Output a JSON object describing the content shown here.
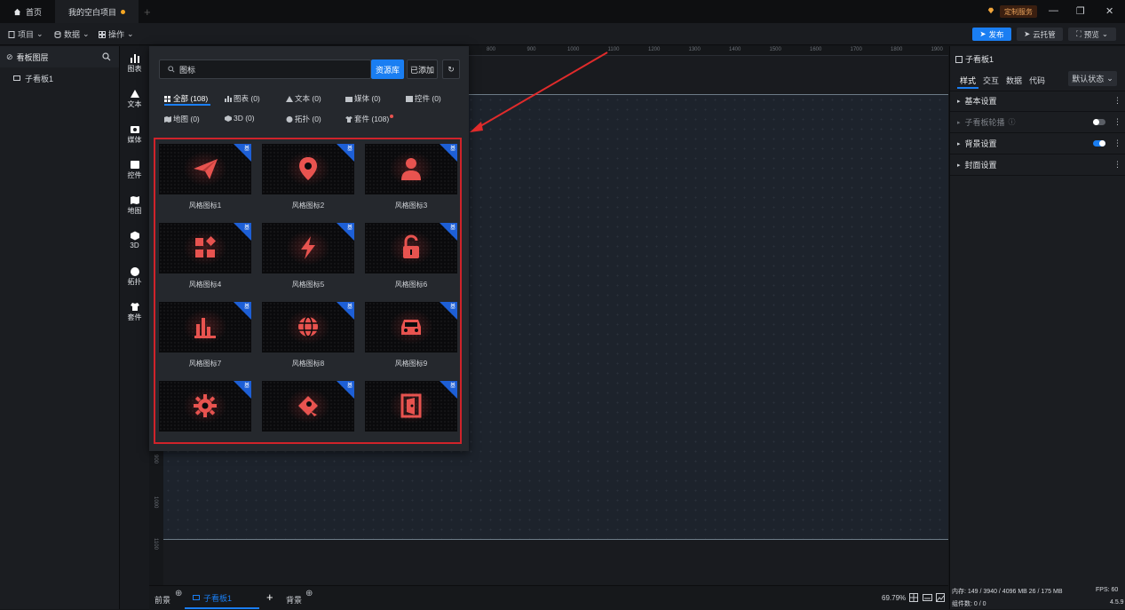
{
  "titlebar": {
    "home_tab": "首页",
    "project_tab": "我的空白项目",
    "custom_service": "定制服务"
  },
  "toolbar": {
    "menu_project": "项目",
    "menu_data": "数据",
    "menu_ops": "操作",
    "publish": "发布",
    "cloud_host": "云托管",
    "preview": "预览"
  },
  "layers": {
    "header": "看板图层",
    "items": [
      "子看板1"
    ]
  },
  "iconbar": {
    "items": [
      "图表",
      "文本",
      "媒体",
      "控件",
      "地图",
      "3D",
      "拓扑",
      "套件"
    ]
  },
  "resource": {
    "search_value": "图标",
    "btn_library": "资源库",
    "btn_added": "已添加",
    "categories": [
      {
        "label": "全部 (108)"
      },
      {
        "label": "图表 (0)"
      },
      {
        "label": "文本 (0)"
      },
      {
        "label": "媒体 (0)"
      },
      {
        "label": "控件 (0)"
      },
      {
        "label": "地图 (0)"
      },
      {
        "label": "3D (0)"
      },
      {
        "label": "拓扑 (0)"
      },
      {
        "label": "套件 (108)"
      }
    ],
    "corner_tag": "基",
    "cards": [
      {
        "label": "风格图标1",
        "icon": "paper-plane-icon"
      },
      {
        "label": "风格图标2",
        "icon": "location-pin-icon"
      },
      {
        "label": "风格图标3",
        "icon": "user-icon"
      },
      {
        "label": "风格图标4",
        "icon": "apps-icon"
      },
      {
        "label": "风格图标5",
        "icon": "lightning-icon"
      },
      {
        "label": "风格图标6",
        "icon": "unlock-icon"
      },
      {
        "label": "风格图标7",
        "icon": "bar-chart-icon"
      },
      {
        "label": "风格图标8",
        "icon": "globe-icon"
      },
      {
        "label": "风格图标9",
        "icon": "car-icon"
      },
      {
        "label": "",
        "icon": "gear-icon"
      },
      {
        "label": "",
        "icon": "camera-icon"
      },
      {
        "label": "",
        "icon": "exit-door-icon"
      }
    ]
  },
  "ruler": {
    "top_ticks": [
      "800",
      "900",
      "1000",
      "1100",
      "1200",
      "1300",
      "1400",
      "1500",
      "1600",
      "1700",
      "1800",
      "1900"
    ],
    "left_ticks": [
      "900",
      "1000",
      "1100"
    ]
  },
  "bottom": {
    "foreground": "前景",
    "board_tab": "子看板1",
    "background": "背景",
    "zoom": "69.79%"
  },
  "rightpanel": {
    "title": "子看板1",
    "tabs": [
      "样式",
      "交互",
      "数据",
      "代码"
    ],
    "state_select": "默认状态",
    "sections": [
      {
        "label": "基本设置",
        "muted": false
      },
      {
        "label": "子看板轮播",
        "muted": true
      },
      {
        "label": "背景设置",
        "muted": false
      },
      {
        "label": "封面设置",
        "muted": false
      }
    ],
    "status_memory": "内存: 149 / 3940 / 4096 MB  26 / 175 MB",
    "status_fps": "FPS: 60",
    "status_components": "组件数: 0 / 0",
    "version": "4.5.9"
  },
  "colors": {
    "accent": "#1a7ef2",
    "highlight_frame": "#d0232a",
    "arrow": "#e02b2b",
    "icon_red": "#e8534f"
  }
}
